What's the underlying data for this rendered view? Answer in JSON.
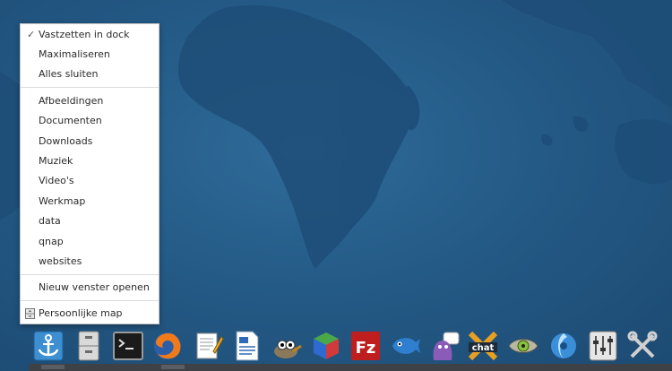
{
  "context_menu": {
    "items_top": [
      {
        "label": "Vastzetten in dock",
        "checked": true
      },
      {
        "label": "Maximaliseren"
      },
      {
        "label": "Alles sluiten"
      }
    ],
    "places": [
      {
        "label": "Afbeeldingen"
      },
      {
        "label": "Documenten"
      },
      {
        "label": "Downloads"
      },
      {
        "label": "Muziek"
      },
      {
        "label": "Video's"
      },
      {
        "label": "Werkmap"
      },
      {
        "label": "data"
      },
      {
        "label": "qnap"
      },
      {
        "label": "websites"
      }
    ],
    "new_window": "Nieuw venster openen",
    "home": "Persoonlijke map",
    "check_glyph": "✓"
  },
  "dock": {
    "icons": [
      "anchor-dock-icon",
      "file-cabinet-icon",
      "terminal-icon",
      "firefox-icon",
      "text-editor-icon",
      "writer-document-icon",
      "gimp-icon",
      "cube-app-icon",
      "filezilla-icon",
      "fish-app-icon",
      "pidgin-icon",
      "xchat-icon",
      "eye-gear-icon",
      "shotwell-icon",
      "settings-panel-icon",
      "tools-icon"
    ],
    "filezilla_text": "Fz",
    "xchat_text": "chat"
  }
}
